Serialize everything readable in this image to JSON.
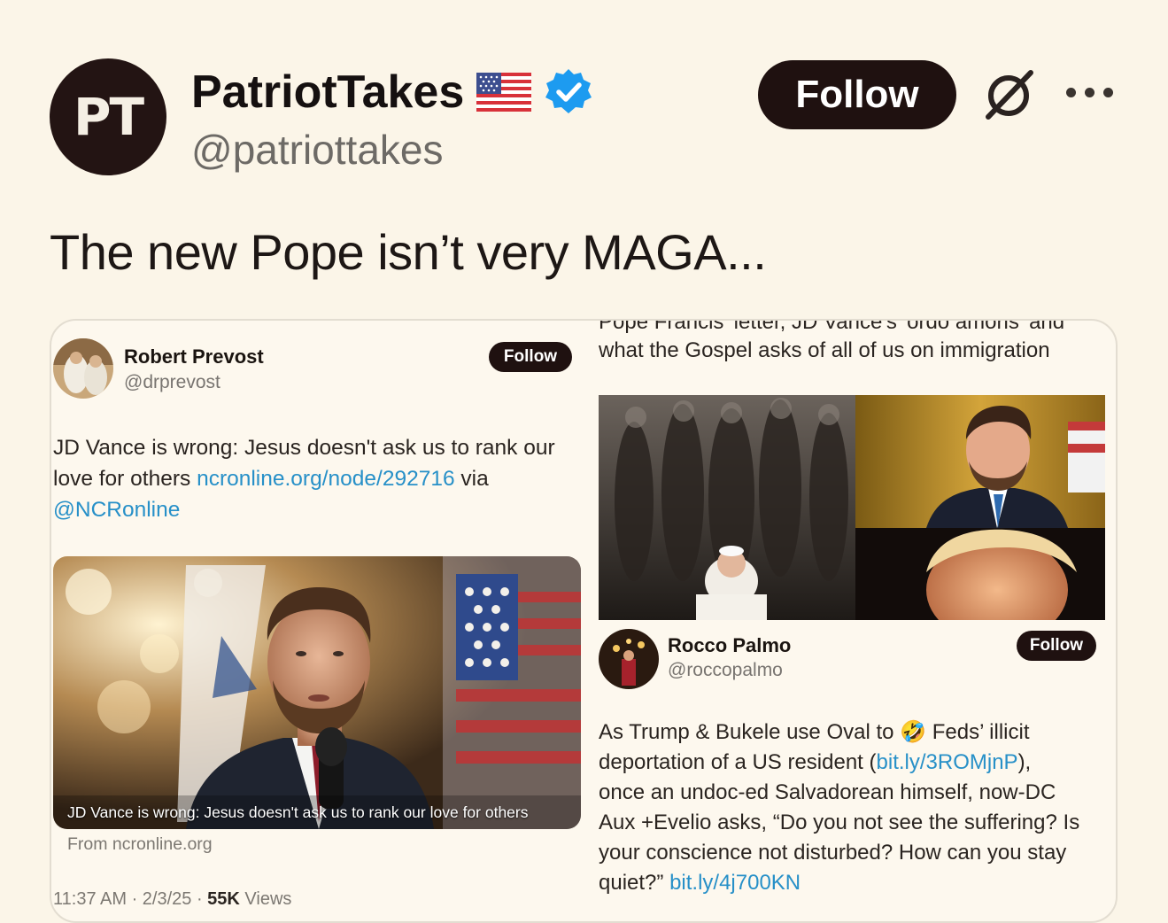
{
  "author": {
    "display_name": "PatriotTakes",
    "handle": "@patriottakes",
    "avatar_text": "PT",
    "follow_label": "Follow",
    "icons": [
      "us-flag-icon",
      "verified-badge-icon",
      "grok-icon",
      "more-icon"
    ]
  },
  "tweet": {
    "text": "The new Pope isn’t very MAGA..."
  },
  "embedded_left": {
    "display_name": "Robert Prevost",
    "handle": "@drprevost",
    "follow_label": "Follow",
    "text_part1": "JD Vance is wrong: Jesus doesn't ask us to rank our love for others ",
    "link1": "ncronline.org/node/292716",
    "text_part2": " via ",
    "link2": "@NCRonline",
    "card_caption": "JD Vance is wrong: Jesus doesn't ask us to rank our love for others",
    "card_source": "From ncronline.org",
    "time": "11:37 AM · 2/3/25 · ",
    "views_count": "55K",
    "views_label": " Views"
  },
  "embedded_right": {
    "cut_text": "Pope Francis' letter, JD Vance's 'ordo amoris' and",
    "title_text": "what the Gospel asks of all of us on immigration",
    "display_name": "Rocco Palmo",
    "handle": "@roccopalmo",
    "follow_label": "Follow",
    "line1_a": "As Trump & Bukele use Oval to ",
    "line1_emoji": "🤣",
    "line1_b": " Feds’ illicit",
    "line2_a": "deportation of a US resident (",
    "line2_link": "bit.ly/3ROMjnP",
    "line2_b": "),",
    "line3": "once an undoc-ed Salvadorean himself, now-DC",
    "line4": "Aux +Evelio asks, “Do you not see the suffering? Is",
    "line5": "your conscience not disturbed? How can you stay",
    "line6_a": "quiet?” ",
    "line6_link": "bit.ly/4j700KN"
  },
  "colors": {
    "background": "#fbf5e8",
    "follow_button": "#1f1110",
    "link": "#2790c8",
    "verified": "#1d9bf0"
  }
}
